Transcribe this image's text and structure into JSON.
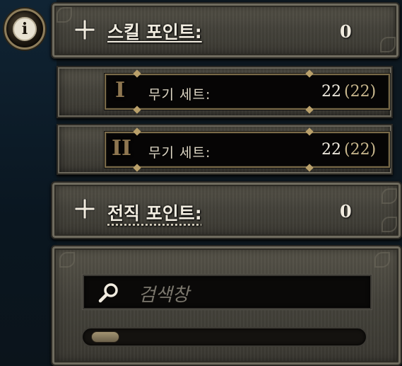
{
  "skill_points": {
    "label": "스킬 포인트:",
    "value": "0",
    "icon": "cross-icon"
  },
  "weapon_sets": [
    {
      "numeral": "I",
      "label": "무기 세트:",
      "value": "22",
      "max": "(22)"
    },
    {
      "numeral": "II",
      "label": "무기 세트:",
      "value": "22",
      "max": "(22)"
    }
  ],
  "job_points": {
    "label": "전직 포인트:",
    "value": "0",
    "icon": "cross-icon"
  },
  "search": {
    "placeholder": "검색창",
    "icon": "search-icon"
  },
  "info_button": {
    "glyph": "i"
  },
  "scrollbar": {
    "position": 0
  },
  "colors": {
    "text": "#f1ece0",
    "gold_border": "#7a6a48",
    "stone": "#4a4840",
    "numeral": "#8e7650"
  }
}
